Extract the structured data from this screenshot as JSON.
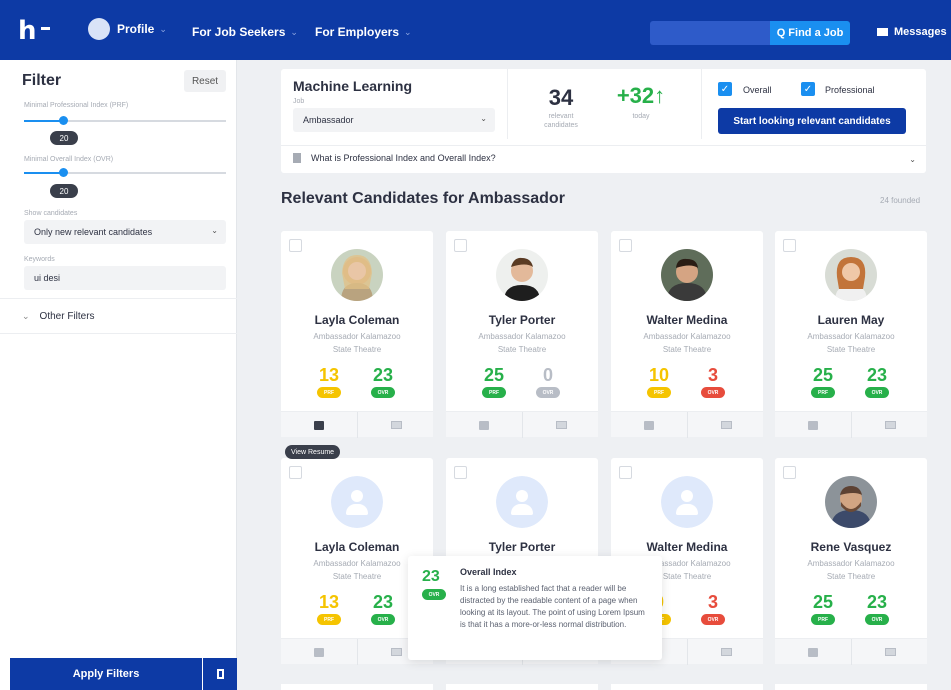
{
  "colors": {
    "brand": "#0d3aa5",
    "accent": "#1a8ff0",
    "green": "#27b04a",
    "yellow": "#f5c400",
    "red": "#e74c3c",
    "grey": "#b8bdc6"
  },
  "topbar": {
    "logo": "h",
    "profile_label": "Profile",
    "job_seekers_label": "For Job Seekers",
    "employers_label": "For Employers",
    "search_placeholder": "",
    "find_job_label": "Q Find a Job",
    "messages_label": "Messages"
  },
  "sidebar": {
    "title": "Filter",
    "reset_label": "Reset",
    "prf_label": "Minimal Professional Index (PRF)",
    "prf_value": "20",
    "ovr_label": "Minimal Overall Index (OVR)",
    "ovr_value": "20",
    "show_label": "Show candidates",
    "show_value": "Only new relevant candidates",
    "keywords_label": "Keywords",
    "keywords_value": "ui desi",
    "other_filters_label": "Other Filters",
    "apply_label": "Apply Filters"
  },
  "header": {
    "job_title": "Machine Learning",
    "job_label": "Job",
    "job_value": "Ambassador",
    "relevant_count": "34",
    "relevant_caption": "relevant candidates",
    "today_count": "+32↑",
    "today_caption": "today",
    "overall_label": "Overall",
    "professional_label": "Professional",
    "start_label": "Start looking relevant candidates",
    "info_label": "What is Professional Index and Overall Index?"
  },
  "section": {
    "title": "Relevant Candidates for Ambassador",
    "founded": "24 founded"
  },
  "cards": [
    {
      "name": "Layla Coleman",
      "sub1": "Ambassador Kalamazoo",
      "sub2": "State Theatre",
      "prf": "13",
      "prf_color": "#f5c400",
      "ovr": "23",
      "ovr_color": "#27b04a",
      "photo": "woman-blonde"
    },
    {
      "name": "Tyler Porter",
      "sub1": "Ambassador Kalamazoo",
      "sub2": "State Theatre",
      "prf": "25",
      "prf_color": "#27b04a",
      "ovr": "0",
      "ovr_color": "#b8bdc6",
      "photo": "man-smile"
    },
    {
      "name": "Walter Medina",
      "sub1": "Ambassador Kalamazoo",
      "sub2": "State Theatre",
      "prf": "10",
      "prf_color": "#f5c400",
      "ovr": "3",
      "ovr_color": "#e74c3c",
      "photo": "man-dark"
    },
    {
      "name": "Lauren May",
      "sub1": "Ambassador Kalamazoo",
      "sub2": "State Theatre",
      "prf": "25",
      "prf_color": "#27b04a",
      "ovr": "23",
      "ovr_color": "#27b04a",
      "photo": "woman-red"
    },
    {
      "name": "Layla Coleman",
      "sub1": "Ambassador Kalamazoo",
      "sub2": "State Theatre",
      "prf": "13",
      "prf_color": "#f5c400",
      "ovr": "23",
      "ovr_color": "#27b04a",
      "photo": "placeholder"
    },
    {
      "name": "Tyler Porter",
      "sub1": "",
      "sub2": "",
      "prf": "",
      "prf_color": "#27b04a",
      "ovr": "",
      "ovr_color": "#27b04a",
      "photo": "placeholder"
    },
    {
      "name": "Walter Medina",
      "sub1": "Ambassador Kalamazoo",
      "sub2": "State Theatre",
      "prf": "0",
      "prf_color": "#f5c400",
      "ovr": "3",
      "ovr_color": "#e74c3c",
      "photo": "placeholder"
    },
    {
      "name": "Rene Vasquez",
      "sub1": "Ambassador Kalamazoo",
      "sub2": "State Theatre",
      "prf": "25",
      "prf_color": "#27b04a",
      "ovr": "23",
      "ovr_color": "#27b04a",
      "photo": "man-beard"
    }
  ],
  "badges": {
    "prf": "PRF",
    "ovr": "OVR"
  },
  "tooltip_resume": "View Resume",
  "popover": {
    "score": "23",
    "badge": "OVR",
    "title": "Overall Index",
    "text": "It is a long established fact that a reader will be distracted by the readable content of a page when looking at its layout. The point of using Lorem Ipsum is that it has a more-or-less normal distribution."
  }
}
